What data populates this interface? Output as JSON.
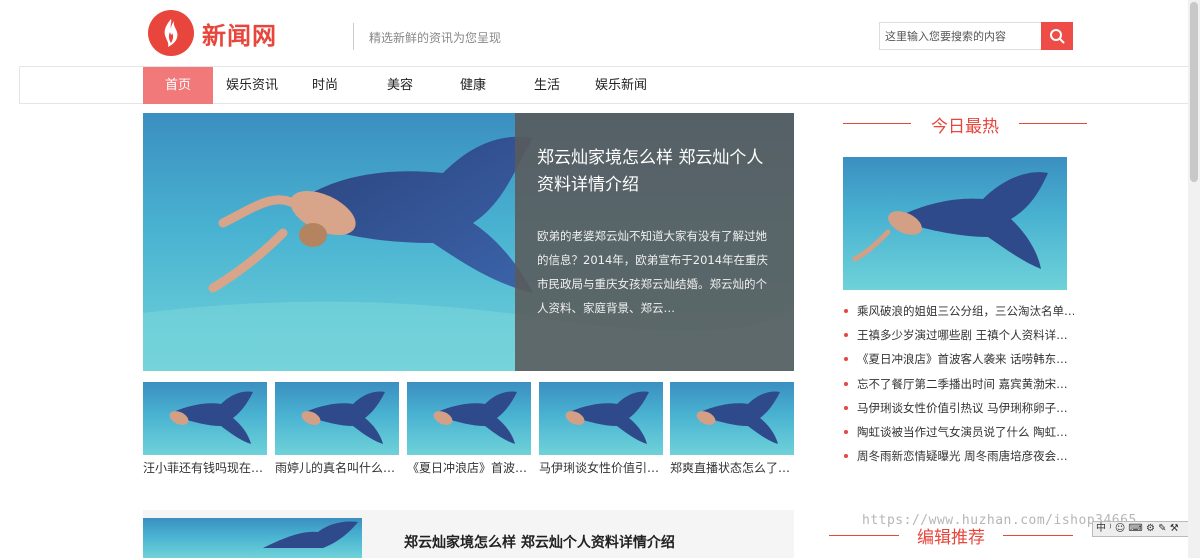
{
  "header": {
    "logo_text": "新闻网",
    "slogan": "精选新鲜的资讯为您呈现",
    "search_placeholder": "这里输入您要搜索的内容"
  },
  "nav": {
    "items": [
      {
        "label": "首页",
        "active": true
      },
      {
        "label": "娱乐资讯",
        "active": false
      },
      {
        "label": "时尚",
        "active": false
      },
      {
        "label": "美容",
        "active": false
      },
      {
        "label": "健康",
        "active": false
      },
      {
        "label": "生活",
        "active": false
      },
      {
        "label": "娱乐新闻",
        "active": false
      }
    ]
  },
  "hero": {
    "title": "郑云灿家境怎么样 郑云灿个人资料详情介绍",
    "description": "欧弟的老婆郑云灿不知道大家有没有了解过她的信息？2014年，欧弟宣布于2014年在重庆市民政局与重庆女孩郑云灿结婚。郑云灿的个人资料、家庭背景、郑云…"
  },
  "thumbs": [
    {
      "caption": "汪小菲还有钱吗现在…"
    },
    {
      "caption": "雨婷儿的真名叫什么…"
    },
    {
      "caption": "《夏日冲浪店》首波…"
    },
    {
      "caption": "马伊琍谈女性价值引…"
    },
    {
      "caption": "郑爽直播状态怎么了…"
    }
  ],
  "bottom_article": {
    "title": "郑云灿家境怎么样 郑云灿个人资料详情介绍"
  },
  "sidebar": {
    "hot_heading": "今日最热",
    "hot_list": [
      "乘风破浪的姐姐三公分组，三公淘汰名单…",
      "王禛多少岁演过哪些剧 王禛个人资料详…",
      "《夏日冲浪店》首波客人袭来 话唠韩东…",
      "忘不了餐厅第二季播出时间 嘉宾黄渤宋…",
      "马伊琍谈女性价值引热议 马伊琍称卵子…",
      "陶虹谈被当作过气女演员说了什么 陶虹…",
      "周冬雨新恋情疑曝光 周冬雨唐培彦夜会…"
    ],
    "editor_heading": "编辑推荐"
  },
  "overlay": {
    "watermark": "https://www.huzhan.com/ishop34665",
    "ime_text": "中 ⁾ ☺ ⌨ ⚙ ✎ ⚒"
  },
  "colors": {
    "brand_red": "#e8453c",
    "nav_active": "#f2797a",
    "search_button": "#ee4c47",
    "hero_overlay": "#5a5a5a"
  }
}
